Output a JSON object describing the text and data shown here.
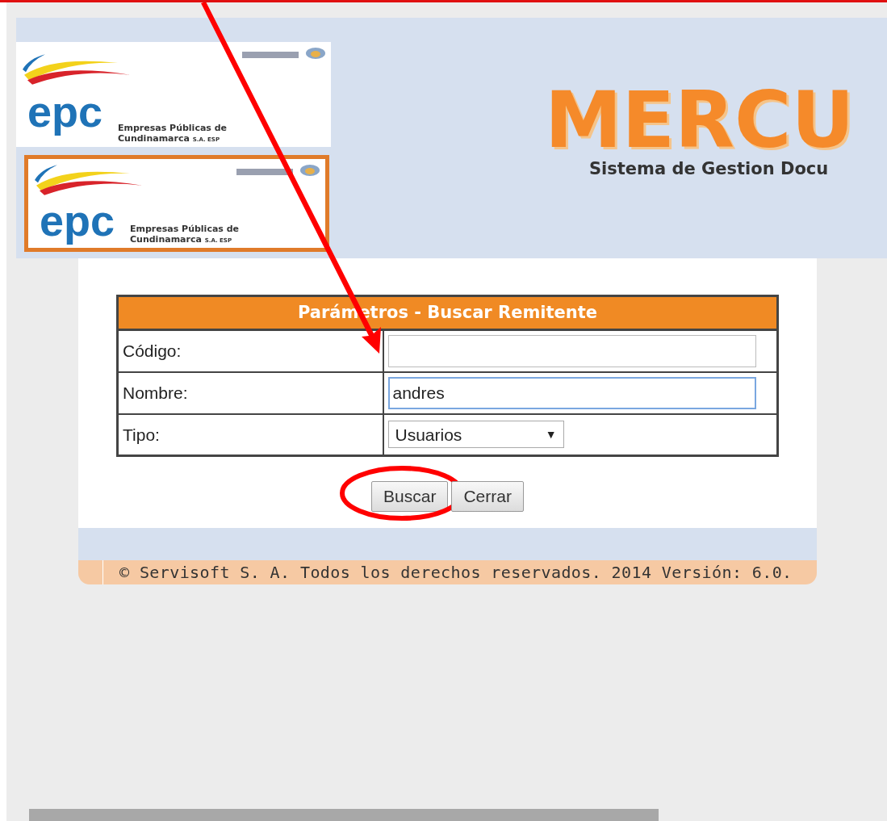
{
  "header": {
    "logos": [
      {
        "wordmark": "epc",
        "line1": "Empresas Públicas de",
        "line2": "Cundinamarca",
        "suffix": "S.A. ESP",
        "framed": false
      },
      {
        "wordmark": "epc",
        "line1": "Empresas Públicas de",
        "line2": "Cundinamarca",
        "suffix": "S.A. ESP",
        "framed": true
      }
    ],
    "brand": "MERCU",
    "tagline": "Sistema de Gestion Docu"
  },
  "form": {
    "title": "Parámetros - Buscar Remitente",
    "fields": [
      {
        "kind": "text",
        "label": "Código:",
        "focused": false
      },
      {
        "kind": "text",
        "label": "Nombre:",
        "value": "andres",
        "focused": true
      },
      {
        "kind": "select",
        "label": "Tipo:",
        "value": "Usuarios",
        "arrow": "▼"
      }
    ],
    "buttons": [
      {
        "label": "Buscar",
        "highlighted": true
      },
      {
        "label": "Cerrar",
        "highlighted": false
      }
    ]
  },
  "footer": "© Servisoft S. A. Todos los derechos reservados. 2014 Versión: 6.0."
}
